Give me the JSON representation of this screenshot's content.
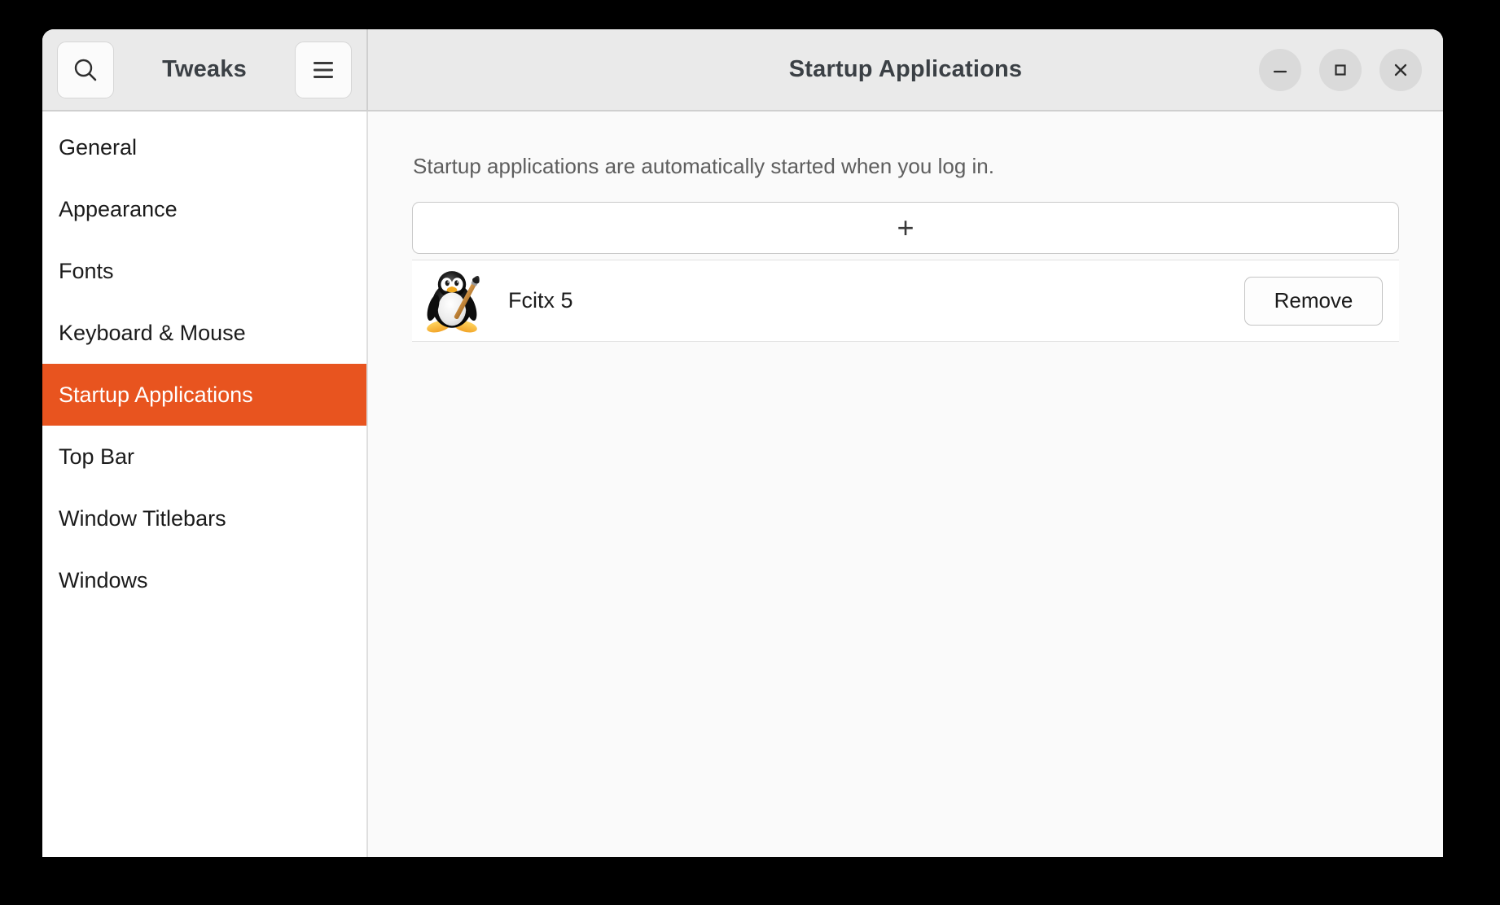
{
  "window": {
    "app_name": "Tweaks",
    "page_title": "Startup Applications"
  },
  "header": {
    "search_icon": "search-icon",
    "menu_icon": "hamburger-menu-icon",
    "minimize_label": "—",
    "maximize_label": "□",
    "close_label": "✕"
  },
  "sidebar": {
    "items": [
      {
        "label": "General",
        "selected": false
      },
      {
        "label": "Appearance",
        "selected": false
      },
      {
        "label": "Fonts",
        "selected": false
      },
      {
        "label": "Keyboard & Mouse",
        "selected": false
      },
      {
        "label": "Startup Applications",
        "selected": true
      },
      {
        "label": "Top Bar",
        "selected": false
      },
      {
        "label": "Window Titlebars",
        "selected": false
      },
      {
        "label": "Windows",
        "selected": false
      }
    ]
  },
  "main": {
    "description": "Startup applications are automatically started when you log in.",
    "add_button_label": "+",
    "apps": [
      {
        "name": "Fcitx 5",
        "icon": "tux-penguin-paintbrush-icon",
        "action_label": "Remove"
      }
    ]
  },
  "colors": {
    "accent": "#e8541f",
    "headerbar": "#eaeaea",
    "content_bg": "#fafafa",
    "sidebar_bg": "#ffffff",
    "desktop_bg": "#000000"
  }
}
